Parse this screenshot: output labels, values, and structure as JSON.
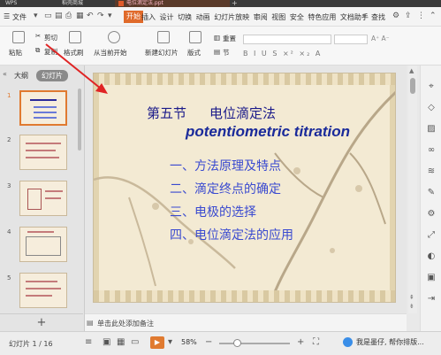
{
  "tabs": {
    "tab1": "WPS",
    "tab2": "稻壳商城",
    "tab3": "电位滴定法.ppt"
  },
  "menubar": {
    "file": "文件",
    "start": "开始",
    "menus": [
      "插入",
      "设计",
      "切换",
      "动画",
      "幻灯片放映",
      "审阅",
      "视图",
      "安全",
      "特色应用",
      "文档助手"
    ],
    "search": "查找"
  },
  "ribbon": {
    "paste": "粘贴",
    "cut": "剪切",
    "copy": "复制",
    "format_painter": "格式刷",
    "from_current": "从当前开始",
    "new_slide": "新建幻灯片",
    "layout": "版式",
    "reset": "重置",
    "section": "节"
  },
  "leftpane": {
    "tab_outline": "大纲",
    "tab_slides": "幻灯片",
    "slide_numbers": [
      "1",
      "2",
      "3",
      "4",
      "5"
    ]
  },
  "slide": {
    "title_part1": "第五节",
    "title_part2": "电位滴定法",
    "subtitle": "potentiometric titration",
    "items": [
      "一、方法原理及特点",
      "二、滴定终点的确定",
      "三、电极的选择",
      "四、电位滴定法的应用"
    ]
  },
  "notes": {
    "placeholder": "单击此处添加备注"
  },
  "status": {
    "slide_info": "幻灯片 1 / 16",
    "zoom": "58%",
    "assistant": "我是墨仔, 帮你排版..."
  },
  "colors": {
    "accent": "#e07a30",
    "title": "#1b1b8a",
    "list": "#3a4ad0"
  }
}
